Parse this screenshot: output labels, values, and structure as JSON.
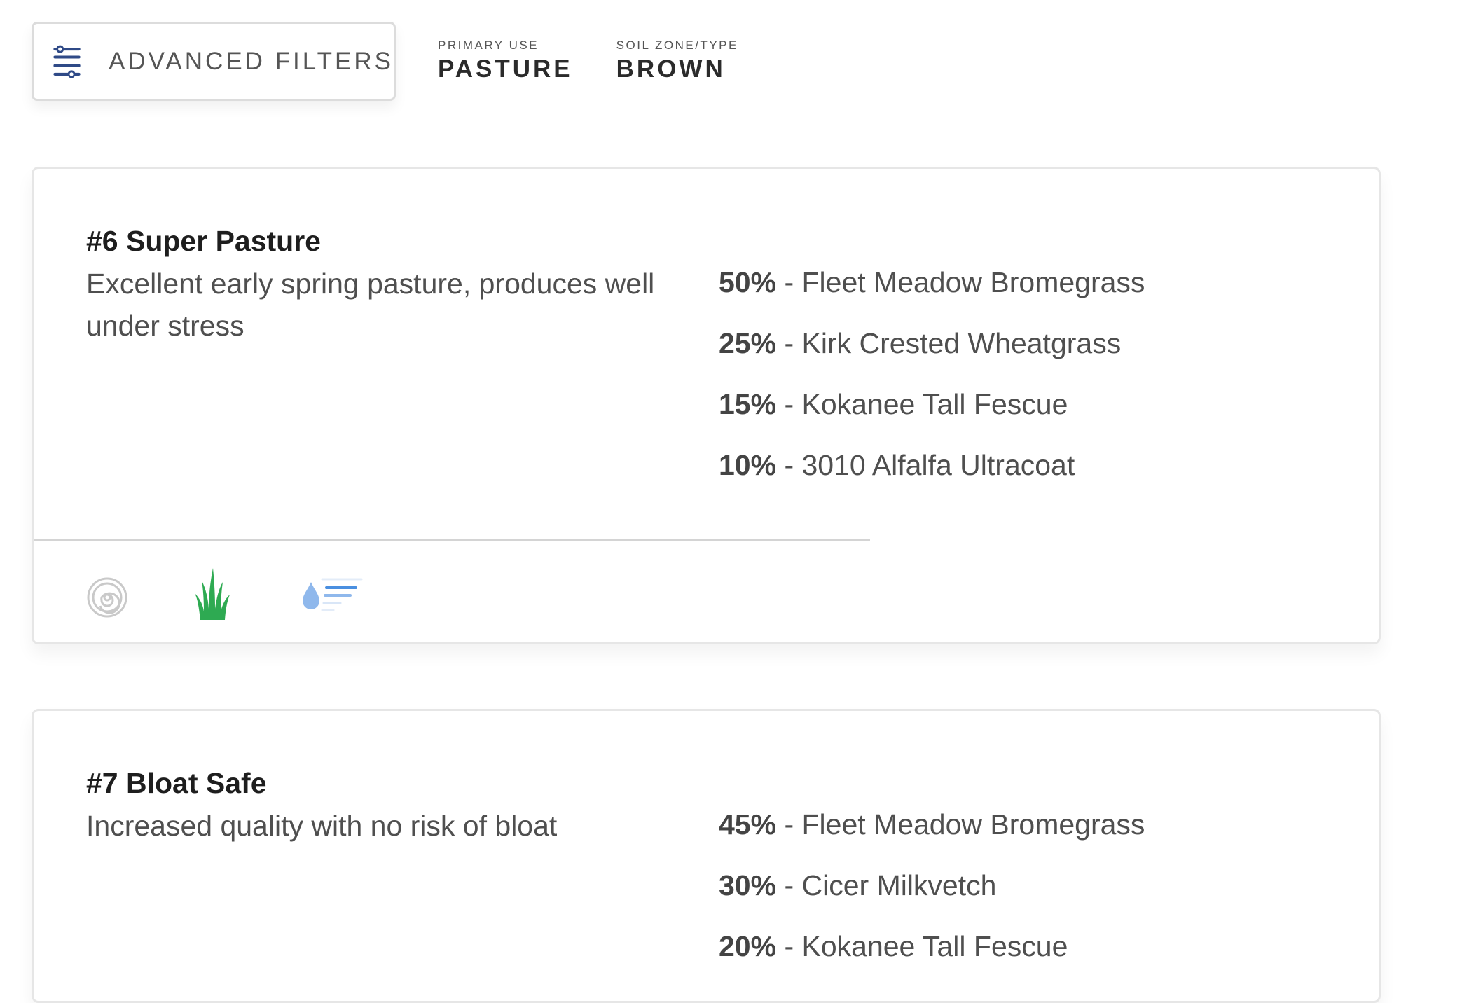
{
  "filters": {
    "advanced_label": "ADVANCED FILTERS",
    "advanced_icon": "sliders-icon",
    "chips": [
      {
        "label": "PRIMARY USE",
        "value": "PASTURE"
      },
      {
        "label": "SOIL ZONE/TYPE",
        "value": "BROWN"
      }
    ]
  },
  "colors": {
    "icon_navy": "#2f4a87",
    "grass_green": "#2eaa52",
    "water_blue": "#8fb8ec",
    "spiral_gray": "#c9c9c9"
  },
  "cards": [
    {
      "title": "#6 Super Pasture",
      "description": "Excellent early spring pasture, produces well under stress",
      "mix": [
        {
          "pct": "50%",
          "name": " - Fleet Meadow Bromegrass"
        },
        {
          "pct": "25%",
          "name": " - Kirk Crested Wheatgrass"
        },
        {
          "pct": "15%",
          "name": " - Kokanee Tall Fescue"
        },
        {
          "pct": "10%",
          "name": " - 3010 Alfalfa Ultracoat"
        }
      ],
      "trait_icons": [
        "spiral-icon",
        "grass-icon",
        "water-drop-icon"
      ]
    },
    {
      "title": "#7 Bloat Safe",
      "description": "Increased quality with no risk of bloat",
      "mix": [
        {
          "pct": "45%",
          "name": " - Fleet Meadow Bromegrass"
        },
        {
          "pct": "30%",
          "name": " - Cicer Milkvetch"
        },
        {
          "pct": "20%",
          "name": " - Kokanee Tall Fescue"
        }
      ]
    }
  ]
}
